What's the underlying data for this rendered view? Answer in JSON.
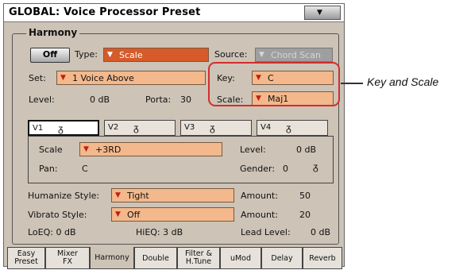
{
  "window": {
    "title": "GLOBAL: Voice Processor Preset"
  },
  "harmony": {
    "group_label": "Harmony",
    "off_button": "Off",
    "type_label": "Type:",
    "type_value": "Scale",
    "source_label": "Source:",
    "source_value": "Chord Scan",
    "set_label": "Set:",
    "set_value": "1 Voice Above",
    "key_label": "Key:",
    "key_value": "C",
    "scale_label": "Scale:",
    "scale_value": "Maj1",
    "level_label": "Level:",
    "level_value": "0 dB",
    "porta_label": "Porta:",
    "porta_value": "30"
  },
  "voices": {
    "tabs": [
      {
        "label": "V1",
        "icon": "mask-icon"
      },
      {
        "label": "V2",
        "icon": "mask-icon"
      },
      {
        "label": "V3",
        "icon": "mask-icon"
      },
      {
        "label": "V4",
        "icon": "mask-icon"
      }
    ],
    "scale_label": "Scale",
    "scale_value": "+3RD",
    "level_label": "Level:",
    "level_value": "0 dB",
    "pan_label": "Pan:",
    "pan_value": "C",
    "gender_label": "Gender:",
    "gender_value": "0"
  },
  "styles": {
    "humanize_label": "Humanize Style:",
    "humanize_value": "Tight",
    "humanize_amount_label": "Amount:",
    "humanize_amount_value": "50",
    "vibrato_label": "Vibrato Style:",
    "vibrato_value": "Off",
    "vibrato_amount_label": "Amount:",
    "vibrato_amount_value": "20"
  },
  "eq": {
    "loeq": "LoEQ: 0 dB",
    "hieq": "HiEQ: 3 dB",
    "lead_level_label": "Lead Level:",
    "lead_level_value": "0 dB"
  },
  "bottom_tabs": [
    {
      "line1": "Easy",
      "line2": "Preset"
    },
    {
      "line1": "Mixer",
      "line2": "FX"
    },
    {
      "line1": "Harmony",
      "line2": ""
    },
    {
      "line1": "Double",
      "line2": ""
    },
    {
      "line1": "Filter &",
      "line2": "H.Tune"
    },
    {
      "line1": "uMod",
      "line2": ""
    },
    {
      "line1": "Delay",
      "line2": ""
    },
    {
      "line1": "Reverb",
      "line2": ""
    }
  ],
  "callout": {
    "text": "Key and Scale"
  },
  "colors": {
    "field": "#f3b88c",
    "selected_field": "#d65a2a",
    "highlight": "#d42d2d",
    "background": "#cdc3b6"
  }
}
